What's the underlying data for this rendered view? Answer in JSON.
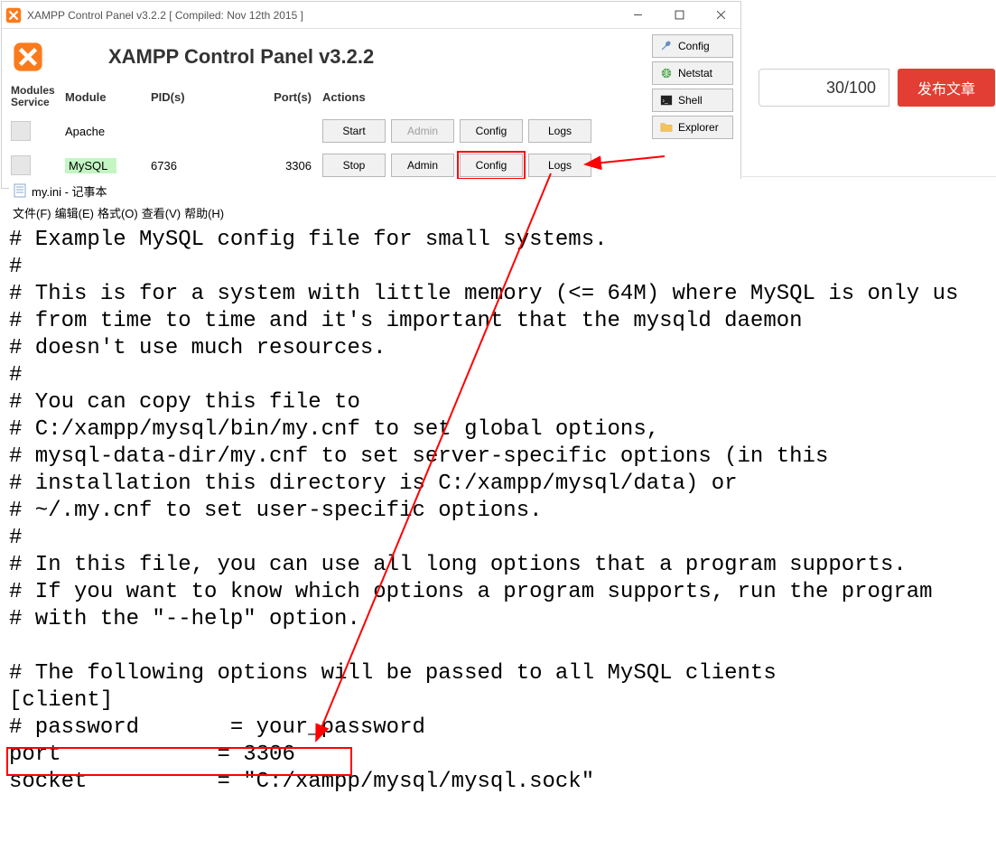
{
  "background": {
    "counter": "30/100",
    "publish": "发布文章"
  },
  "xampp": {
    "title": "XAMPP Control Panel v3.2.2   [ Compiled: Nov 12th 2015 ]",
    "big_title": "XAMPP Control Panel v3.2.2",
    "side_labels": {
      "modules": "Modules",
      "service": "Service"
    },
    "columns": {
      "module": "Module",
      "pids": "PID(s)",
      "ports": "Port(s)",
      "actions": "Actions"
    },
    "rows": [
      {
        "module": "Apache",
        "pid": "",
        "port": "",
        "buttons": [
          "Start",
          "Admin",
          "Config",
          "Logs"
        ],
        "admin_disabled": true,
        "running": false
      },
      {
        "module": "MySQL",
        "pid": "6736",
        "port": "3306",
        "buttons": [
          "Stop",
          "Admin",
          "Config",
          "Logs"
        ],
        "admin_disabled": false,
        "running": true
      }
    ],
    "right_buttons": [
      {
        "key": "config",
        "label": "Config"
      },
      {
        "key": "netstat",
        "label": "Netstat"
      },
      {
        "key": "shell",
        "label": "Shell"
      },
      {
        "key": "explorer",
        "label": "Explorer"
      }
    ]
  },
  "notepad": {
    "title": "my.ini - 记事本",
    "menu": [
      "文件(F)",
      "编辑(E)",
      "格式(O)",
      "查看(V)",
      "帮助(H)"
    ],
    "text": "# Example MySQL config file for small systems.\n#\n# This is for a system with little memory (<= 64M) where MySQL is only us\n# from time to time and it's important that the mysqld daemon\n# doesn't use much resources.\n#\n# You can copy this file to\n# C:/xampp/mysql/bin/my.cnf to set global options,\n# mysql-data-dir/my.cnf to set server-specific options (in this\n# installation this directory is C:/xampp/mysql/data) or\n# ~/.my.cnf to set user-specific options.\n#\n# In this file, you can use all long options that a program supports.\n# If you want to know which options a program supports, run the program\n# with the \"--help\" option.\n\n# The following options will be passed to all MySQL clients\n[client]\n# password       = your_password\nport            = 3306\nsocket          = \"C:/xampp/mysql/mysql.sock\""
  }
}
